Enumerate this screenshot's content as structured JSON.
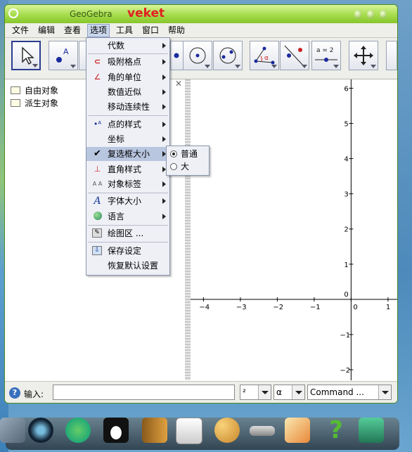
{
  "window": {
    "title": "GeoGebra",
    "brand": "veket"
  },
  "menubar": [
    {
      "label": "文件"
    },
    {
      "label": "编辑"
    },
    {
      "label": "查看"
    },
    {
      "label": "选项",
      "active": true
    },
    {
      "label": "工具"
    },
    {
      "label": "窗口"
    },
    {
      "label": "帮助"
    }
  ],
  "toolbar": {
    "tools": [
      "move-tool-icon",
      "point-tool-icon",
      "line-tool-icon",
      "perpendicular-tool-icon",
      "polygon-tool-icon",
      "circle-tool-icon",
      "ellipse-tool-icon",
      "angle-tool-icon",
      "reflect-tool-icon",
      "slider-tool-icon",
      "move-view-tool-icon",
      "extra-tool-icon"
    ],
    "slider_label": "a = 2"
  },
  "algebra_view": {
    "items": [
      {
        "label": "自由对象"
      },
      {
        "label": "派生对象"
      }
    ]
  },
  "options_menu": {
    "items": [
      {
        "label": "代数",
        "icon": "",
        "submenu": true
      },
      {
        "label": "吸附格点",
        "icon": "magnet-icon",
        "submenu": true
      },
      {
        "label": "角的单位",
        "icon": "angle-unit-icon",
        "submenu": true
      },
      {
        "label": "数值近似",
        "icon": "",
        "submenu": true
      },
      {
        "label": "移动连续性",
        "icon": "",
        "submenu": true
      },
      {
        "label": "点的样式",
        "icon": "point-style-icon",
        "submenu": true
      },
      {
        "label": "坐标",
        "icon": "",
        "submenu": true
      },
      {
        "label": "复选框大小",
        "icon": "checkmark-icon",
        "submenu": true,
        "highlighted": true
      },
      {
        "label": "直角样式",
        "icon": "right-angle-icon",
        "submenu": true
      },
      {
        "label": "对象标签",
        "icon": "label-icon",
        "submenu": true
      },
      {
        "label": "字体大小",
        "icon": "font-icon",
        "submenu": true
      },
      {
        "label": "语言",
        "icon": "globe-icon",
        "submenu": true
      },
      {
        "label": "绘图区 ...",
        "icon": "graphics-settings-icon",
        "submenu": false
      },
      {
        "label": "保存设定",
        "icon": "save-settings-icon",
        "submenu": false
      },
      {
        "label": "恢复默认设置",
        "icon": "",
        "submenu": false
      }
    ],
    "checkbox_size_submenu": [
      {
        "label": "普通",
        "selected": true
      },
      {
        "label": "大",
        "selected": false
      }
    ]
  },
  "graphics_view": {
    "x_ticks": [
      -4,
      -3,
      -2,
      -1,
      0,
      1
    ],
    "y_ticks": [
      6,
      5,
      4,
      3,
      2,
      1,
      0,
      -1,
      -2
    ],
    "x_range": [
      -4.35,
      1.25
    ],
    "y_range": [
      -2.3,
      6.25
    ]
  },
  "input_bar": {
    "label": "输入:",
    "value": "",
    "combo_power": "²",
    "combo_greek": "α",
    "combo_command": "Command ..."
  },
  "dock": {
    "apps": [
      "tool-icon",
      "media-player-icon",
      "messenger-icon",
      "penguin-icon",
      "contacts-icon",
      "presentation-icon",
      "paint-icon",
      "usb-drive-icon",
      "pet-game-icon",
      "help-icon",
      "camera-icon"
    ]
  },
  "colors": {
    "titlebar": "#a6dc4d",
    "menu_highlight": "#b9c6e0",
    "brand": "#e02020"
  }
}
